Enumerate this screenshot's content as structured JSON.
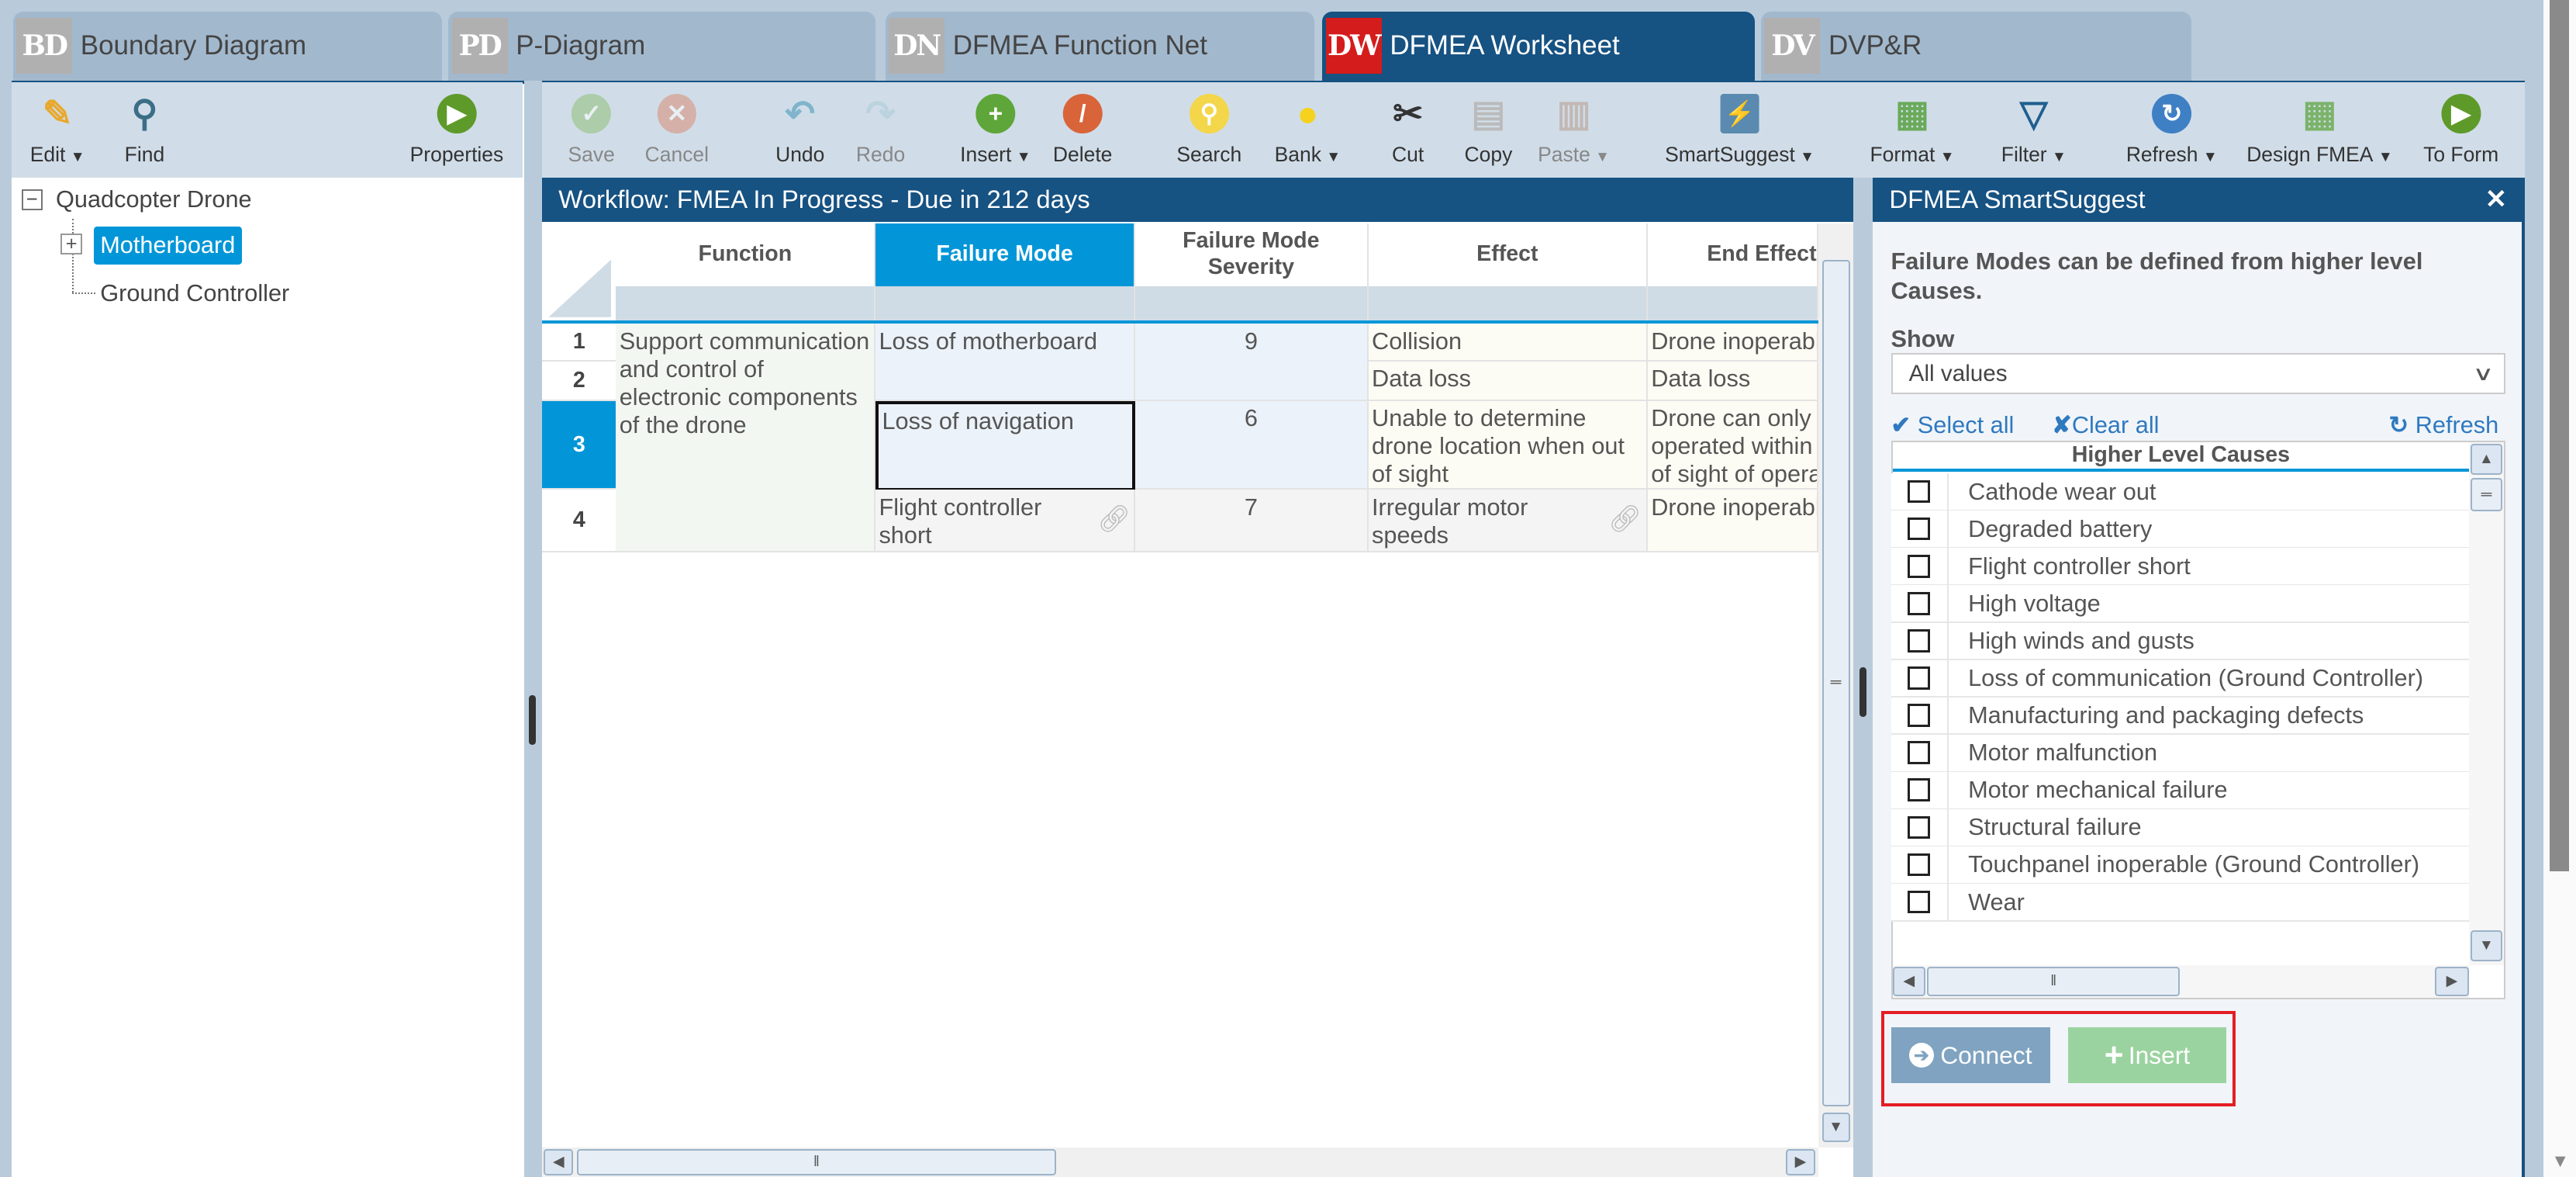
{
  "tabs": [
    {
      "badge": "BD",
      "label": "Boundary Diagram",
      "active": false
    },
    {
      "badge": "PD",
      "label": "P-Diagram",
      "active": false
    },
    {
      "badge": "DN",
      "label": "DFMEA Function Net",
      "active": false
    },
    {
      "badge": "DW",
      "label": "DFMEA Worksheet",
      "active": true
    },
    {
      "badge": "DV",
      "label": "DVP&R",
      "active": false
    }
  ],
  "left_toolbar": [
    {
      "label": "Edit",
      "icon": "pencil-icon",
      "glyph": "✎",
      "color": "#e8a82c",
      "dropdown": true,
      "plain": true
    },
    {
      "label": "Find",
      "icon": "magnifier-icon",
      "glyph": "⚲",
      "color": "#3b6e86",
      "dropdown": false,
      "plain": true
    },
    {
      "label": "Properties",
      "icon": "arrow-right-circle-icon",
      "glyph": "▶",
      "color": "#5e9a2a",
      "dropdown": false
    }
  ],
  "main_toolbar": [
    {
      "label": "Save",
      "icon": "check-circle-icon",
      "glyph": "✓",
      "color": "#8fbf78",
      "disabled": true
    },
    {
      "label": "Cancel",
      "icon": "x-circle-icon",
      "glyph": "✕",
      "color": "#d98c75",
      "disabled": true
    },
    {
      "label": "Undo",
      "icon": "undo-icon",
      "glyph": "↶",
      "color": "#7fb4cc",
      "plain": true
    },
    {
      "label": "Redo",
      "icon": "redo-icon",
      "glyph": "↷",
      "color": "#a9cbd9",
      "plain": true,
      "disabled": true
    },
    {
      "label": "Insert",
      "icon": "plus-circle-icon",
      "glyph": "+",
      "color": "#5fa63a",
      "dropdown": true
    },
    {
      "label": "Delete",
      "icon": "minus-circle-icon",
      "glyph": "/",
      "color": "#d9643a"
    },
    {
      "label": "Search",
      "icon": "lightbulb-search-icon",
      "glyph": "⚲",
      "color": "#f3d64a"
    },
    {
      "label": "Bank",
      "icon": "lightbulb-icon",
      "glyph": "●",
      "color": "#f4d21e",
      "dropdown": true,
      "plain": true
    },
    {
      "label": "Cut",
      "icon": "scissors-icon",
      "glyph": "✂",
      "color": "#333",
      "plain": true
    },
    {
      "label": "Copy",
      "icon": "copy-icon",
      "glyph": "▤",
      "color": "#bbb",
      "plain": true
    },
    {
      "label": "Paste",
      "icon": "paste-icon",
      "glyph": "▥",
      "color": "#b79a8a",
      "plain": true,
      "disabled": true,
      "dropdown": true
    },
    {
      "label": "SmartSuggest",
      "icon": "smartsuggest-icon",
      "glyph": "⚡",
      "color": "#5b8ab0",
      "sq": true,
      "dropdown": true
    },
    {
      "label": "Format",
      "icon": "grid-format-icon",
      "glyph": "▦",
      "color": "#6aaa5a",
      "plain": true,
      "dropdown": true
    },
    {
      "label": "Filter",
      "icon": "funnel-icon",
      "glyph": "▽",
      "color": "#1f5f8f",
      "plain": true,
      "dropdown": true
    },
    {
      "label": "Refresh",
      "icon": "refresh-icon",
      "glyph": "↻",
      "color": "#3f7fc4",
      "dropdown": true
    },
    {
      "label": "Design FMEA",
      "icon": "design-grid-icon",
      "glyph": "▦",
      "color": "#7bb36a",
      "plain": true,
      "dropdown": true
    },
    {
      "label": "To Form",
      "icon": "to-form-arrow-icon",
      "glyph": "▶",
      "color": "#5e9a2a"
    }
  ],
  "tree": {
    "root": "Quadcopter Drone",
    "children": [
      "Motherboard",
      "Ground Controller"
    ],
    "selected": "Motherboard"
  },
  "worksheet": {
    "workflow": "Workflow: FMEA In Progress - Due in 212 days",
    "columns": [
      "Function",
      "Failure Mode",
      "Failure Mode Severity",
      "Effect",
      "End Effect"
    ],
    "row_numbers": [
      "1",
      "2",
      "3",
      "4"
    ],
    "function": "Support communication and control of electronic components of the drone",
    "failure_modes": [
      "Loss of motherboard",
      "Loss of navigation",
      "Flight controller short"
    ],
    "severities": [
      "9",
      "6",
      "7"
    ],
    "effects": [
      "Collision",
      "Data loss",
      "Unable to determine drone location when out of sight",
      "Irregular motor speeds"
    ],
    "end_effects": [
      "Drone inoperable",
      "Data loss",
      "Drone can only be operated within line of sight of operator",
      "Drone inoperable"
    ]
  },
  "smartsuggest": {
    "title": "DFMEA SmartSuggest",
    "close": "✕",
    "description": "Failure Modes can be defined from higher level Causes.",
    "show_label": "Show",
    "show_value": "All values",
    "select_all": "Select all",
    "clear_all": "Clear all",
    "refresh": "Refresh",
    "list_header": "Higher Level Causes",
    "items": [
      "Cathode wear out",
      "Degraded battery",
      "Flight controller short",
      "High voltage",
      "High winds and gusts",
      "Loss of communication (Ground Controller)",
      "Manufacturing and packaging defects",
      "Motor malfunction",
      "Motor mechanical failure",
      "Structural failure",
      "Touchpanel inoperable (Ground Controller)",
      "Wear"
    ],
    "connect": "Connect",
    "insert": "Insert"
  }
}
